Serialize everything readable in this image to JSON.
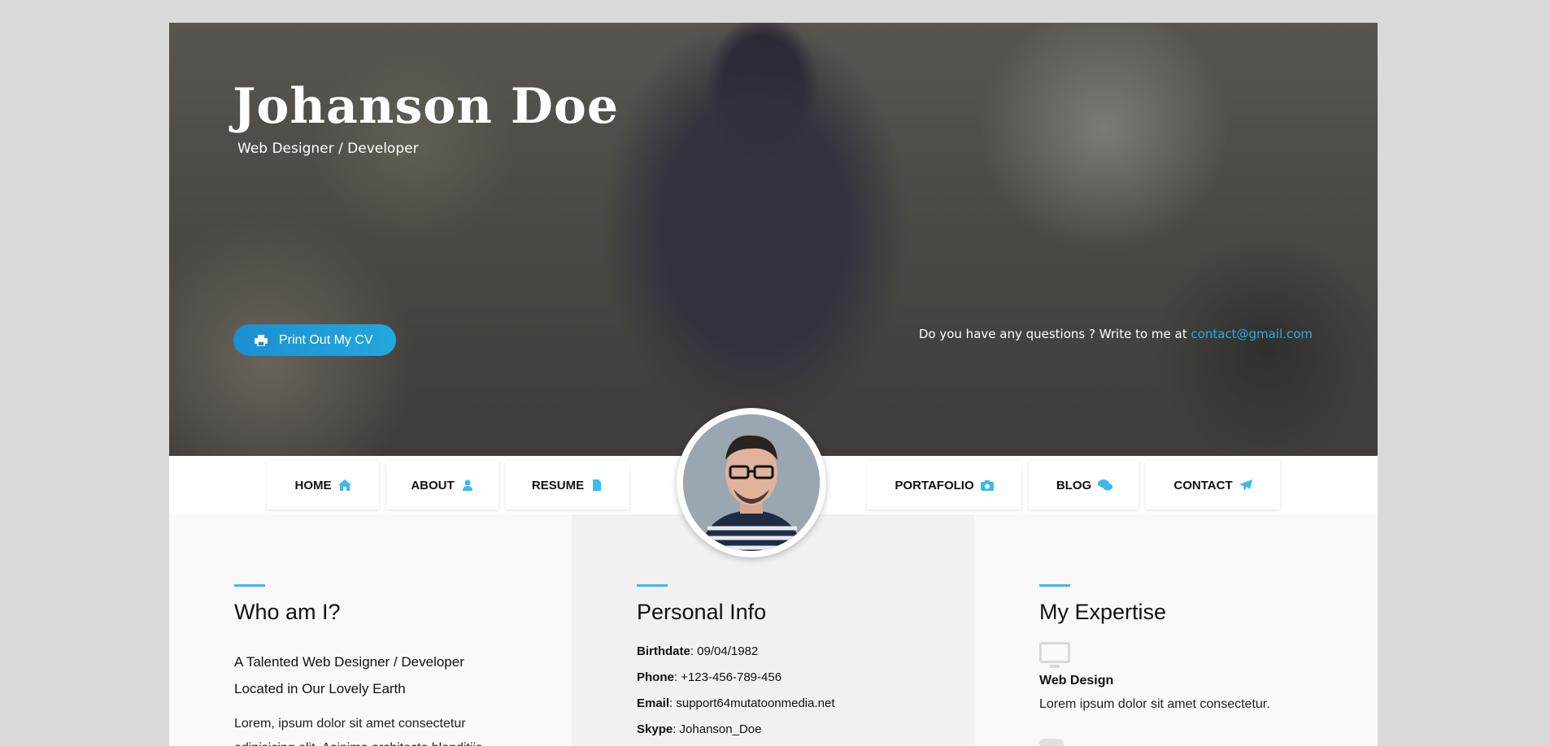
{
  "hero": {
    "name": "Johanson Doe",
    "role": "Web Designer / Developer",
    "print_label": "Print Out My CV",
    "contact_prefix": "Do you have any questions ? Write to me at",
    "contact_email": "contact@gmail.com"
  },
  "nav": {
    "items": [
      {
        "label": "HOME",
        "icon": "home-icon"
      },
      {
        "label": "ABOUT",
        "icon": "user-icon"
      },
      {
        "label": "RESUME",
        "icon": "file-icon"
      },
      {
        "label": "PORTAFOLIO",
        "icon": "camera-icon"
      },
      {
        "label": "BLOG",
        "icon": "comments-icon"
      },
      {
        "label": "CONTACT",
        "icon": "paper-plane-icon"
      }
    ]
  },
  "about": {
    "title": "Who am I?",
    "subtitle": "A Talented Web Designer / Developer Located in Our Lovely Earth",
    "text": "Lorem, ipsum dolor sit amet consectetur adipisicing elit. Asinimo architecto blanditiis"
  },
  "info": {
    "title": "Personal Info",
    "rows": [
      {
        "label": "Birthdate",
        "value": ": 09/04/1982"
      },
      {
        "label": "Phone",
        "value": ": +123-456-789-456"
      },
      {
        "label": "Email",
        "value": ": support64mutatoonmedia.net"
      },
      {
        "label": "Skype",
        "value": ": Johanson_Doe"
      }
    ]
  },
  "expertise": {
    "title": "My Expertise",
    "items": [
      {
        "title": "Web Design",
        "text": "Lorem ipsum dolor sit amet consectetur.",
        "icon": "monitor-icon"
      }
    ]
  },
  "colors": {
    "accent": "#29aee6",
    "button": "#1b8fd0"
  }
}
